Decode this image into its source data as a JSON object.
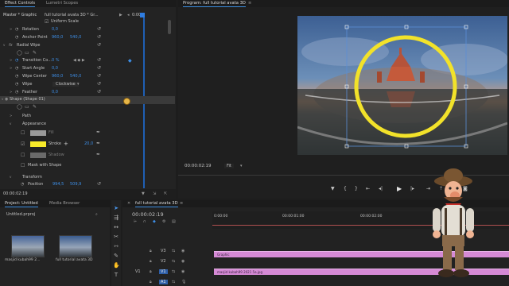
{
  "effect_controls": {
    "tabs": [
      "Effect Controls",
      "Lumetri Scopes"
    ],
    "source_label": "Master * Graphic",
    "sequence_label": "full tutorial avata 3D * Gr...",
    "uniform_scale": "Uniform Scale",
    "rotation": {
      "label": "Rotation",
      "value": "0,0"
    },
    "anchor_point": {
      "label": "Anchor Point",
      "x": "960,0",
      "y": "540,0"
    },
    "radial_wipe": {
      "label": "Radial Wipe",
      "fx": "fx"
    },
    "transition_completion": {
      "label": "Transition Co...",
      "value": "0 %"
    },
    "start_angle": {
      "label": "Start Angle",
      "value": "0,0"
    },
    "wipe_center": {
      "label": "Wipe Center",
      "x": "960,0",
      "y": "540,0"
    },
    "wipe": {
      "label": "Wipe",
      "value": "Clockwise"
    },
    "feather": {
      "label": "Feather",
      "value": "0,0"
    },
    "shape": {
      "label": "Shape (Shape 01)"
    },
    "path": "Path",
    "appearance": "Appearance",
    "fill": {
      "label": "Fill",
      "color": "#9a9a9a"
    },
    "stroke": {
      "label": "Stroke",
      "value": "20,0",
      "color": "#f7ea2a"
    },
    "shadow": {
      "label": "Shadow",
      "color": "#6a6a6a"
    },
    "mask_with_shape": "Mask with Shape",
    "transform": "Transform",
    "position": {
      "label": "Position",
      "x": "994,5",
      "y": "509,9"
    },
    "timecode": "00:00:02:19"
  },
  "program_monitor": {
    "title": "Program: full tutorial avata 3D",
    "timecode": "00:00:02:19",
    "zoom": "Fit"
  },
  "project": {
    "tabs": [
      "Project: Untitled",
      "Media Browser"
    ],
    "file": "Untitled.prproj",
    "items": [
      {
        "name": "masjid kubah99 2..."
      },
      {
        "name": "full tutorial avata 3D"
      }
    ]
  },
  "timeline": {
    "title": "full tutorial avata 3D",
    "timecode": "00:00:02:19",
    "ruler": [
      "0:00:00",
      "00:00:01:00",
      "00:00:02:00"
    ],
    "tracks": [
      {
        "name": "V3"
      },
      {
        "name": "V2"
      },
      {
        "name": "V1"
      },
      {
        "name": "A1"
      }
    ],
    "clips": [
      {
        "label": "Graphic"
      },
      {
        "label": "masjid kubah99 2021 5a.jpg"
      }
    ]
  },
  "colors": {
    "accent": "#3d8ee6",
    "clip": "#d58ad5",
    "ring": "#f2e22a",
    "playhead": "#2f7de1"
  },
  "icons": [
    "pen-icon",
    "ellipse-icon",
    "rect-icon",
    "reset-icon",
    "eyedropper-icon",
    "play-icon",
    "step-back-icon",
    "step-forward-icon",
    "selection-tool-icon",
    "razor-icon",
    "hand-icon",
    "text-icon"
  ]
}
